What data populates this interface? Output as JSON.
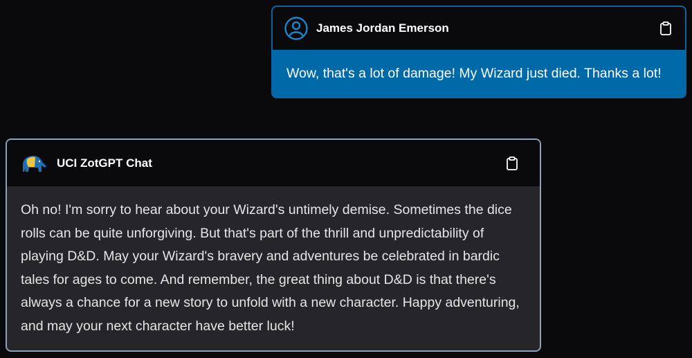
{
  "messages": {
    "user": {
      "name": "James Jordan Emerson",
      "text": "Wow, that's a lot of damage! My Wizard just died. Thanks a lot!",
      "avatar_icon": "user-circle-icon",
      "copy_icon": "clipboard-icon",
      "accent_color": "#0069a8"
    },
    "bot": {
      "name": "UCI ZotGPT Chat",
      "text": "Oh no! I'm sorry to hear about your Wizard's untimely demise. Sometimes the dice rolls can be quite unforgiving. But that's part of the thrill and unpredictability of playing D&D. May your Wizard's bravery and adventures be celebrated in bardic tales for ages to come. And remember, the great thing about D&D is that there's always a chance for a new story to unfold with a new character. Happy adventuring, and may your next character have better luck!",
      "avatar_icon": "anteater-logo-icon",
      "copy_icon": "clipboard-icon"
    }
  }
}
